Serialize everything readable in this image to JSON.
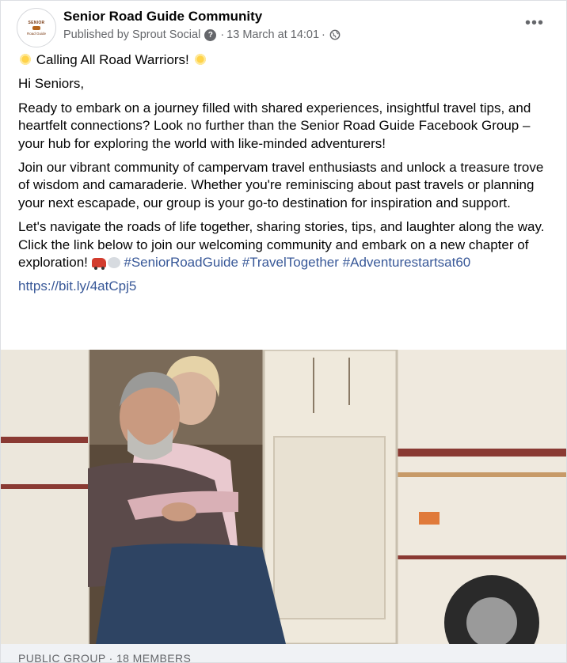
{
  "post": {
    "page_name": "Senior Road Guide Community",
    "avatar_text_top": "SENIOR",
    "avatar_text_bottom": "Road Guide",
    "published_by": "Published by Sprout Social",
    "separator": "·",
    "timestamp": "13 March at 14:01",
    "more_label": "•••"
  },
  "content": {
    "headline": "Calling All Road Warriors!",
    "greeting": "Hi Seniors,",
    "paragraph1": "Ready to embark on a journey filled with shared experiences, insightful travel tips, and heartfelt connections? Look no further than the Senior Road Guide Facebook Group – your hub for exploring the world with like-minded adventurers!",
    "paragraph2": "Join our vibrant community of campervam travel enthusiasts and unlock a treasure trove of wisdom and camaraderie. Whether you're reminiscing about past travels or planning your next escapade, our group is your go-to destination for inspiration and support.",
    "paragraph3": "Let's navigate the roads of life together, sharing stories, tips, and laughter along the way. Click the link below to join our welcoming community and embark on a new chapter of exploration!",
    "hashtags": [
      "#SeniorRoadGuide",
      "#TravelTogether",
      "#Adventurestartsat60"
    ],
    "link": "https://bit.ly/4atCpj5"
  },
  "link_preview": {
    "caption": "PUBLIC GROUP · 18 MEMBERS"
  },
  "icons": {
    "info": "question-icon",
    "privacy": "globe-icon",
    "emoji1": "sun-emoji",
    "emoji2": "car-emoji",
    "emoji3": "dash-emoji"
  }
}
